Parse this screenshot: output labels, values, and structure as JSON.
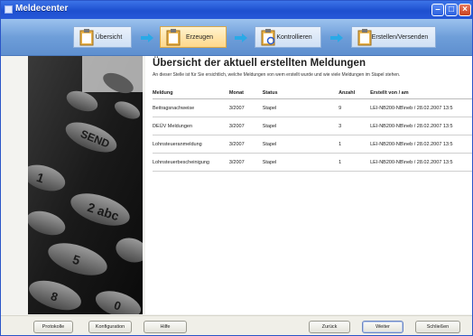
{
  "window": {
    "title": "Meldecenter"
  },
  "steps": [
    {
      "label": "Übersicht",
      "active": false
    },
    {
      "label": "Erzeugen",
      "active": true
    },
    {
      "label": "Kontrollieren",
      "active": false
    },
    {
      "label": "Erstellen/Versenden",
      "active": false
    }
  ],
  "content": {
    "heading": "Übersicht der aktuell erstellten Meldungen",
    "subtext": "An dieser Stelle ist für Sie ersichtlich, welche Meldungen von wem erstellt wurde und wie viele Meldungen im Stapel stehen.",
    "columns": [
      "Meldung",
      "Monat",
      "Status",
      "Anzahl",
      "Erstellt von / am"
    ],
    "rows": [
      [
        "Beitragsnachweise",
        "3/2007",
        "Stapel",
        "9",
        "LEI-NB200-NB\\neb / 28.02.2007 13:5"
      ],
      [
        "DEÜV Meldungen",
        "3/2007",
        "Stapel",
        "3",
        "LEI-NB200-NB\\neb / 28.02.2007 13:5"
      ],
      [
        "Lohnsteueranmeldung",
        "3/2007",
        "Stapel",
        "1",
        "LEI-NB200-NB\\neb / 28.02.2007 13:5"
      ],
      [
        "Lohnsteuerbescheinigung",
        "3/2007",
        "Stapel",
        "1",
        "LEI-NB200-NB\\neb / 28.02.2007 13:5"
      ]
    ]
  },
  "footer": {
    "protokolle": "Protokolle",
    "konfiguration": "Konfiguration",
    "hilfe": "Hilfe",
    "zurueck": "Zurück",
    "weiter": "Weiter",
    "schliessen": "Schließen"
  },
  "photo": {
    "keys": [
      "SEND",
      "1",
      "2 abc",
      "5",
      "8",
      "0"
    ]
  },
  "colors": {
    "titlebar": "#1d4fcf",
    "stepbar": "#6e9ed9",
    "active_step": "#ffd88a",
    "arrow": "#2aa9e6"
  }
}
